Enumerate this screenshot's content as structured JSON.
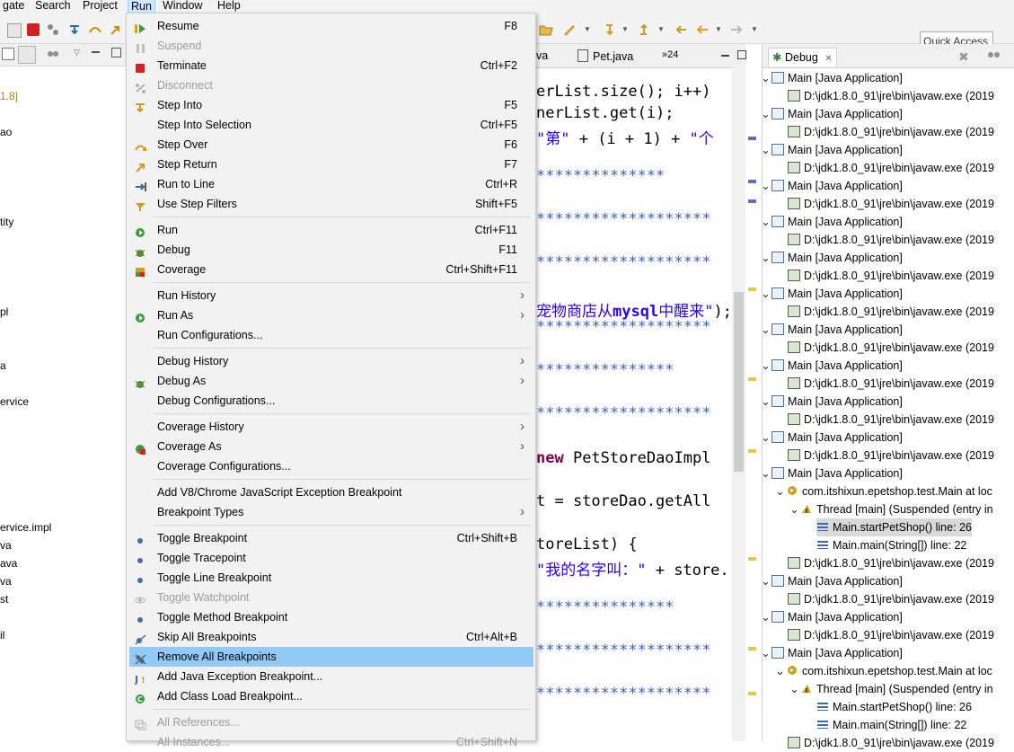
{
  "menubar": {
    "items": [
      "gate",
      "Search",
      "Project",
      "Run",
      "Window",
      "Help"
    ],
    "active": "Run"
  },
  "toolbar": {
    "quick_access_placeholder": "Quick Access"
  },
  "left_pane": {
    "items": [
      "1.8]",
      "ao",
      "tity",
      "pl",
      "a",
      "ervice",
      "ervice.impl",
      "va",
      "ava",
      "va",
      "st",
      "il"
    ]
  },
  "editor": {
    "tabs": [
      "va",
      "Pet.java",
      "»24"
    ],
    "lines": {
      "l1": "erList.size(); i++)",
      "l2": "nerList.get(i);",
      "l3a": "\"第\"",
      "l3b": " + (i + 1) + ",
      "l3c": "\"个",
      "stars1": "**************",
      "stars2": "*******************",
      "stars3": "*******************",
      "l4a": "宠物商店从",
      "l4b": "mysql",
      "l4c": "中醒来\"",
      "l4d": ");",
      "stars4": "*******************",
      "stars5": "***************",
      "stars6": "*******************",
      "l5a": "new",
      "l5b": " PetStoreDaoImpl",
      "l6": "t = storeDao.getAll",
      "l7": "toreList) {",
      "l8a": "\"我的名字叫：\"",
      "l8b": " + store.",
      "stars7": "***************",
      "stars8": "*******************",
      "stars9": "*******************"
    }
  },
  "run_menu": {
    "items": [
      {
        "label": "Resume",
        "key": "F8",
        "icon": "resume-icon"
      },
      {
        "label": "Suspend",
        "key": "",
        "icon": "suspend-icon",
        "disabled": true
      },
      {
        "label": "Terminate",
        "key": "Ctrl+F2",
        "icon": "terminate-icon"
      },
      {
        "label": "Disconnect",
        "key": "",
        "icon": "disconnect-icon",
        "disabled": true
      },
      {
        "label": "Step Into",
        "key": "F5",
        "icon": "step-into-icon"
      },
      {
        "label": "Step Into Selection",
        "key": "Ctrl+F5",
        "icon": ""
      },
      {
        "label": "Step Over",
        "key": "F6",
        "icon": "step-over-icon"
      },
      {
        "label": "Step Return",
        "key": "F7",
        "icon": "step-return-icon"
      },
      {
        "label": "Run to Line",
        "key": "Ctrl+R",
        "icon": "run-to-line-icon"
      },
      {
        "label": "Use Step Filters",
        "key": "Shift+F5",
        "icon": "step-filters-icon"
      },
      {
        "label": "Run",
        "key": "Ctrl+F11",
        "icon": "run-icon"
      },
      {
        "label": "Debug",
        "key": "F11",
        "icon": "debug-icon"
      },
      {
        "label": "Coverage",
        "key": "Ctrl+Shift+F11",
        "icon": "coverage-icon"
      },
      {
        "label": "Run History",
        "key": "",
        "icon": "",
        "submenu": true
      },
      {
        "label": "Run As",
        "key": "",
        "icon": "run-as-icon",
        "submenu": true
      },
      {
        "label": "Run Configurations...",
        "key": "",
        "icon": ""
      },
      {
        "label": "Debug History",
        "key": "",
        "icon": "",
        "submenu": true
      },
      {
        "label": "Debug As",
        "key": "",
        "icon": "debug-as-icon",
        "submenu": true
      },
      {
        "label": "Debug Configurations...",
        "key": "",
        "icon": ""
      },
      {
        "label": "Coverage History",
        "key": "",
        "icon": "",
        "submenu": true
      },
      {
        "label": "Coverage As",
        "key": "",
        "icon": "coverage-as-icon",
        "submenu": true
      },
      {
        "label": "Coverage Configurations...",
        "key": "",
        "icon": ""
      },
      {
        "label": "Add V8/Chrome JavaScript Exception Breakpoint",
        "key": "",
        "icon": ""
      },
      {
        "label": "Breakpoint Types",
        "key": "",
        "icon": "",
        "submenu": true
      },
      {
        "label": "Toggle Breakpoint",
        "key": "Ctrl+Shift+B",
        "icon": "breakpoint-dot-icon"
      },
      {
        "label": "Toggle Tracepoint",
        "key": "",
        "icon": "breakpoint-dot-icon"
      },
      {
        "label": "Toggle Line Breakpoint",
        "key": "",
        "icon": "breakpoint-dot-icon"
      },
      {
        "label": "Toggle Watchpoint",
        "key": "",
        "icon": "watchpoint-icon",
        "disabled": true
      },
      {
        "label": "Toggle Method Breakpoint",
        "key": "",
        "icon": "breakpoint-dot-icon"
      },
      {
        "label": "Skip All Breakpoints",
        "key": "Ctrl+Alt+B",
        "icon": "skip-breakpoints-icon"
      },
      {
        "label": "Remove All Breakpoints",
        "key": "",
        "icon": "remove-breakpoints-icon",
        "highlighted": true
      },
      {
        "label": "Add Java Exception Breakpoint...",
        "key": "",
        "icon": "exception-breakpoint-icon"
      },
      {
        "label": "Add Class Load Breakpoint...",
        "key": "",
        "icon": "class-load-breakpoint-icon"
      },
      {
        "label": "All References...",
        "key": "",
        "icon": "references-icon",
        "disabled": true
      },
      {
        "label": "All Instances...",
        "key": "Ctrl+Shift+N",
        "icon": "",
        "disabled": true
      }
    ]
  },
  "debug_view": {
    "title": "Debug",
    "nodes": [
      {
        "label": "Main [Java Application]",
        "kind": "app"
      },
      {
        "label": "D:\\jdk1.8.0_91\\jre\\bin\\javaw.exe (2019",
        "kind": "proc"
      },
      {
        "label": "com.itshixun.epetshop.test.Main at loc",
        "kind": "vm"
      },
      {
        "label": "Thread [main] (Suspended (entry in",
        "kind": "thread"
      },
      {
        "label": "Main.startPetShop() line: 26",
        "kind": "frame"
      },
      {
        "label": "Main.main(String[]) line: 22",
        "kind": "frame"
      }
    ]
  }
}
